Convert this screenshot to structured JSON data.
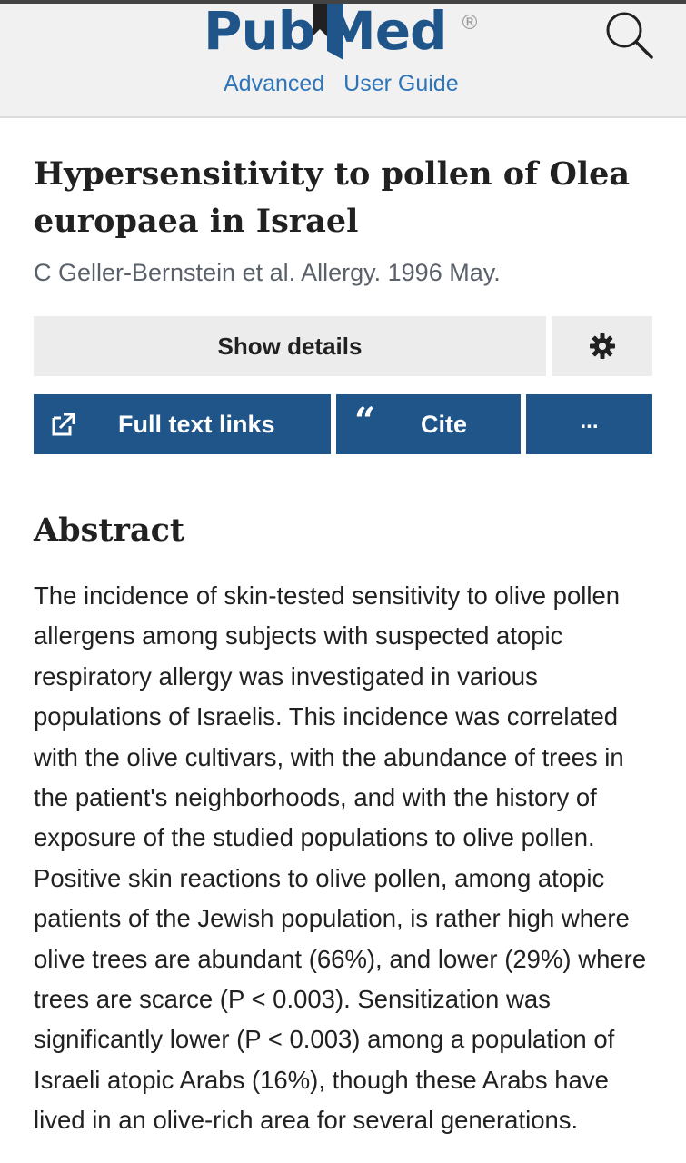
{
  "header": {
    "logo": {
      "part1": "Pub",
      "part2": "Med",
      "registered": "®"
    },
    "links": [
      "Advanced",
      "User Guide"
    ],
    "search_icon": "search-icon"
  },
  "article": {
    "title": "Hypersensitivity to pollen of Olea europaea in Israel",
    "citation": "C Geller-Bernstein et al. Allergy. 1996 May."
  },
  "buttons": {
    "show_details": "Show details",
    "settings_icon": "gear-icon",
    "full_text_links": "Full text links",
    "full_text_icon": "external-link-icon",
    "cite": "Cite",
    "cite_icon": "quote-icon",
    "more": "..."
  },
  "abstract": {
    "heading": "Abstract",
    "text": "The incidence of skin-tested sensitivity to olive pollen allergens among subjects with suspected atopic respiratory allergy was investigated in various populations of Israelis. This incidence was correlated with the olive cultivars, with the abundance of trees in the patient's neighborhoods, and with the history of exposure of the studied populations to olive pollen. Positive skin reactions to olive pollen, among atopic patients of the Jewish population, is rather high where olive trees are abundant (66%), and lower (29%) where trees are scarce (P < 0.003). Sensitization was significantly lower (P < 0.003) among a population of Israeli atopic Arabs (16%), though these Arabs have lived in an olive-rich area for several generations."
  },
  "colors": {
    "brand_blue": "#20558a",
    "link_blue": "#2d74b8",
    "header_bg": "#f1f1f1",
    "button_gray": "#ececec"
  }
}
